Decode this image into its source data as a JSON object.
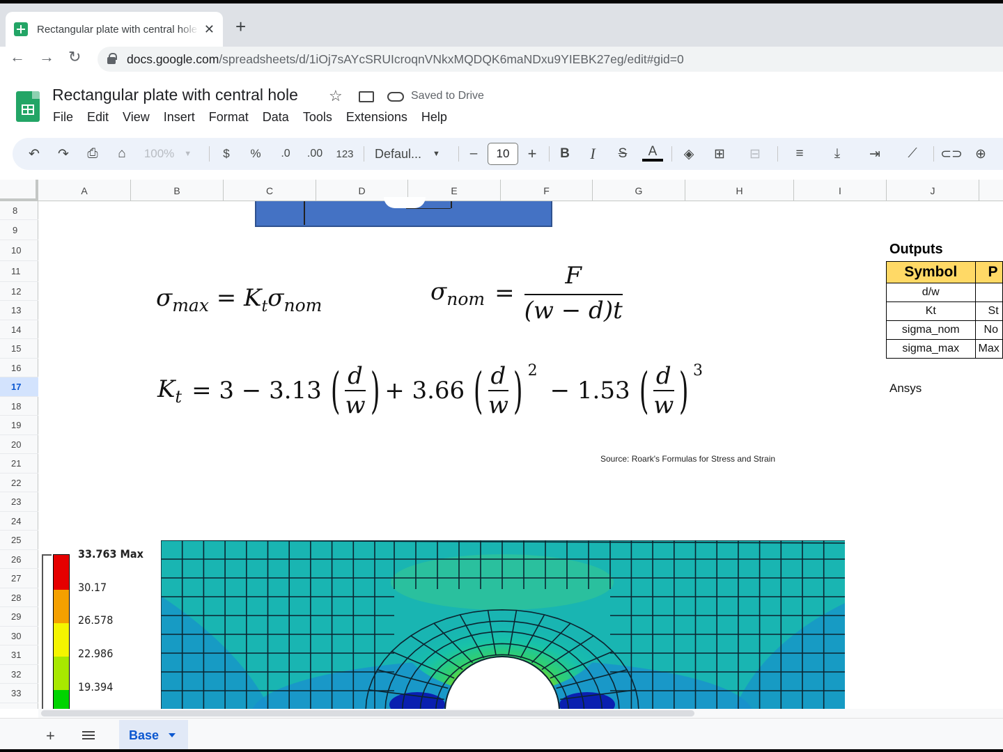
{
  "browser": {
    "tab_title": "Rectangular plate with central hole",
    "tab_close": "✕",
    "new_tab": "+",
    "url_host": "docs.google.com",
    "url_path": "/spreadsheets/d/1iOj7sAYcSRUIcroqnVNkxMQDQK6maNDxu9YIEBK27eg/edit#gid=0",
    "back": "←",
    "forward": "→",
    "reload": "↻"
  },
  "doc": {
    "title": "Rectangular plate with central hole",
    "saved_status": "Saved to Drive",
    "menu": [
      "File",
      "Edit",
      "View",
      "Insert",
      "Format",
      "Data",
      "Tools",
      "Extensions",
      "Help"
    ]
  },
  "toolbar": {
    "zoom": "100%",
    "currency": "$",
    "percent": "%",
    "dec_decrease": ".0",
    "dec_increase": ".00",
    "number_format": "123",
    "font": "Defaul...",
    "minus": "–",
    "font_size": "10",
    "plus": "+",
    "bold": "B",
    "italic": "I",
    "strike": "S",
    "text_color": "A"
  },
  "columns": [
    "A",
    "B",
    "C",
    "D",
    "E",
    "F",
    "G",
    "H",
    "I",
    "J"
  ],
  "rows": [
    "8",
    "9",
    "10",
    "11",
    "12",
    "13",
    "14",
    "15",
    "16",
    "17",
    "18",
    "19",
    "20",
    "21",
    "22",
    "23",
    "24",
    "25",
    "26",
    "27",
    "28",
    "29",
    "30",
    "31",
    "32",
    "33"
  ],
  "selected_row": "17",
  "equations": {
    "sigma_max_lhs": "σ",
    "sigma_max_sub": "max",
    "eq1_rhs": "= K",
    "eq1_t": "t",
    "eq1_sigma": "σ",
    "eq1_nom": "nom",
    "sigma_nom": "σ",
    "sigma_nom_sub": "nom",
    "eq2_eq": "=",
    "eq2_num": "F",
    "eq2_den": "(w − d)t",
    "kt_lhs": "K",
    "kt_sub": "t",
    "kt_a": "= 3 − 3.13",
    "kt_b": "+ 3.66",
    "kt_c": "− 1.53",
    "frac_num": "d",
    "frac_den": "w",
    "pow2": "2",
    "pow3": "3"
  },
  "source_note": "Source: Roark's Formulas for Stress and Strain",
  "outputs": {
    "title": "Outputs",
    "headers": [
      "Symbol",
      "P"
    ],
    "rows": [
      [
        "d/w",
        ""
      ],
      [
        "Kt",
        "St"
      ],
      [
        "sigma_nom",
        "No"
      ],
      [
        "sigma_max",
        "Max"
      ]
    ],
    "ansys_label": "Ansys"
  },
  "legend": {
    "max_label": "33.763 Max",
    "labels": [
      "30.17",
      "26.578",
      "22.986",
      "19.394"
    ],
    "colors": [
      "#e60000",
      "#f5a000",
      "#f5f500",
      "#a8e800",
      "#00d400"
    ]
  },
  "sheet_tabs": {
    "add": "+",
    "active": "Base"
  }
}
